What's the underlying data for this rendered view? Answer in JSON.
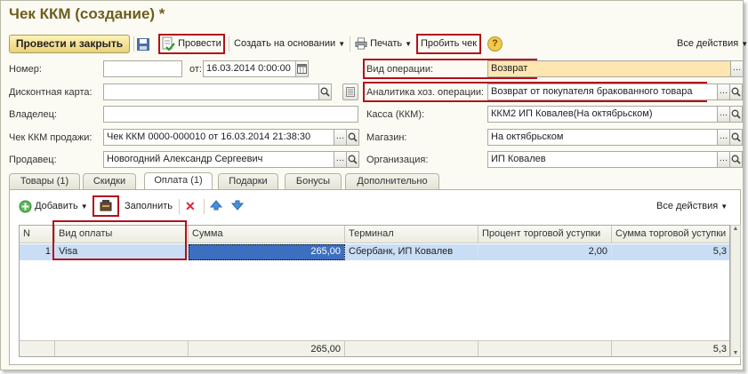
{
  "window": {
    "title": "Чек ККМ (создание) *"
  },
  "toolbar": {
    "post_and_close": "Провести и закрыть",
    "post": "Провести",
    "create_based_on": "Создать на основании",
    "print": "Печать",
    "punch_receipt": "Пробить чек",
    "all_actions": "Все действия",
    "help": "?"
  },
  "form": {
    "number_label": "Номер:",
    "number_value": "",
    "date_from_label": "от:",
    "date_value": "16.03.2014  0:00:00",
    "discount_card_label": "Дисконтная карта:",
    "discount_card_value": "",
    "owner_label": "Владелец:",
    "owner_value": "",
    "sale_receipt_label": "Чек ККМ продажи:",
    "sale_receipt_value": "Чек ККМ 0000-000010 от 16.03.2014 21:38:30",
    "seller_label": "Продавец:",
    "seller_value": "Новогодний Александр Сергеевич",
    "operation_type_label": "Вид операции:",
    "operation_type_value": "Возврат",
    "analytics_label": "Аналитика хоз. операции:",
    "analytics_value": "Возврат от покупателя бракованного товара",
    "cashbox_label": "Касса (ККМ):",
    "cashbox_value": "ККМ2 ИП Ковалев(На октябрьском)",
    "store_label": "Магазин:",
    "store_value": "На октябрьском",
    "organization_label": "Организация:",
    "organization_value": "ИП Ковалев"
  },
  "tabs": [
    {
      "label": "Товары (1)"
    },
    {
      "label": "Скидки"
    },
    {
      "label": "Оплата (1)"
    },
    {
      "label": "Подарки"
    },
    {
      "label": "Бонусы"
    },
    {
      "label": "Дополнительно"
    }
  ],
  "payment_toolbar": {
    "add": "Добавить",
    "fill": "Заполнить",
    "all_actions": "Все действия"
  },
  "grid": {
    "columns": [
      "N",
      "Вид оплаты",
      "Сумма",
      "Терминал",
      "Процент торговой уступки",
      "Сумма торговой уступки"
    ],
    "rows": [
      {
        "n": "1",
        "payment_type": "Visa",
        "amount": "265,00",
        "terminal": "Сбербанк, ИП Ковалев",
        "percent": "2,00",
        "discount_sum": "5,3"
      }
    ],
    "footer": {
      "amount_total": "265,00",
      "discount_total": "5,3"
    }
  },
  "colors": {
    "highlight": "#b0121b",
    "title": "#6e5d1e",
    "operation_bg": "#fde6b0",
    "selected_row": "#c9def5"
  }
}
